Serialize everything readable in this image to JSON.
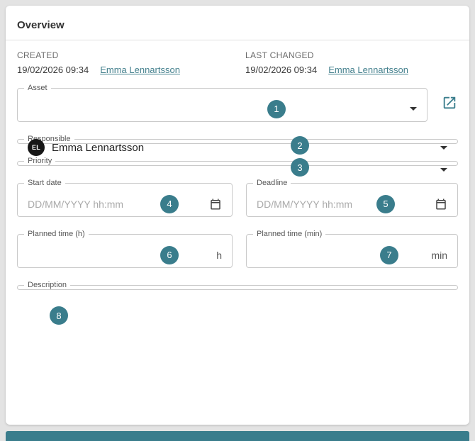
{
  "header": {
    "title": "Overview"
  },
  "meta": {
    "created": {
      "label": "CREATED",
      "date": "19/02/2026 09:34",
      "by": "Emma Lennartsson"
    },
    "changed": {
      "label": "LAST CHANGED",
      "date": "19/02/2026 09:34",
      "by": "Emma Lennartsson"
    }
  },
  "fields": {
    "asset": {
      "label": "Asset",
      "badge": "1"
    },
    "responsible": {
      "label": "Responsible",
      "badge": "2",
      "value": "Emma Lennartsson",
      "avatar_initials": "EL"
    },
    "priority": {
      "label": "Priority",
      "badge": "3"
    },
    "start_date": {
      "label": "Start date",
      "placeholder": "DD/MM/YYYY hh:mm",
      "badge": "4"
    },
    "deadline": {
      "label": "Deadline",
      "placeholder": "DD/MM/YYYY hh:mm",
      "badge": "5"
    },
    "planned_time_h": {
      "label": "Planned time (h)",
      "suffix": "h",
      "badge": "6"
    },
    "planned_time_min": {
      "label": "Planned time (min)",
      "suffix": "min",
      "badge": "7"
    },
    "description": {
      "label": "Description",
      "badge": "8"
    }
  },
  "colors": {
    "accent": "#3A7D8C",
    "link": "#45818E"
  }
}
